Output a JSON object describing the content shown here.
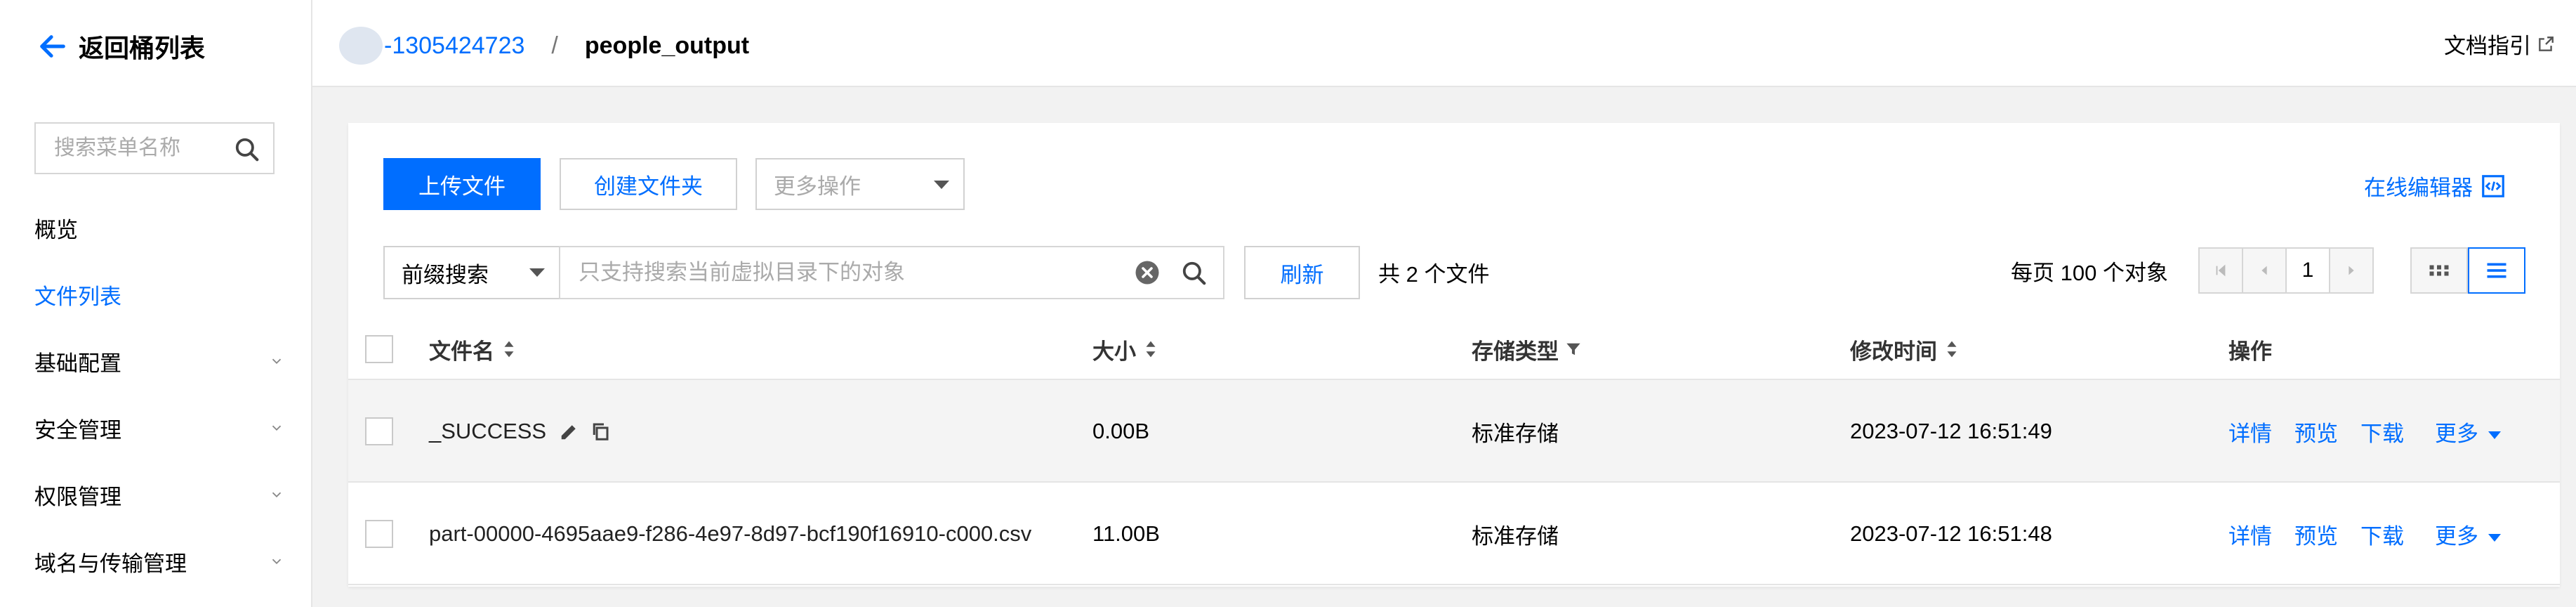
{
  "sidebar": {
    "back_label": "返回桶列表",
    "search_placeholder": "搜索菜单名称",
    "items": [
      {
        "label": "概览",
        "active": false,
        "expandable": false
      },
      {
        "label": "文件列表",
        "active": true,
        "expandable": false
      },
      {
        "label": "基础配置",
        "active": false,
        "expandable": true
      },
      {
        "label": "安全管理",
        "active": false,
        "expandable": true
      },
      {
        "label": "权限管理",
        "active": false,
        "expandable": true
      },
      {
        "label": "域名与传输管理",
        "active": false,
        "expandable": true
      }
    ]
  },
  "header": {
    "bucket": "-1305424723",
    "separator": "/",
    "current": "people_output",
    "doc_link": "文档指引"
  },
  "toolbar": {
    "upload": "上传文件",
    "create_folder": "创建文件夹",
    "more_actions": "更多操作",
    "online_editor": "在线编辑器"
  },
  "search": {
    "mode": "前缀搜索",
    "placeholder": "只支持搜索当前虚拟目录下的对象",
    "refresh": "刷新",
    "total": "共 2 个文件",
    "per_page": "每页 100 个对象",
    "page": "1"
  },
  "table": {
    "headers": {
      "name": "文件名",
      "size": "大小",
      "storage": "存储类型",
      "modified": "修改时间",
      "actions": "操作"
    },
    "rows": [
      {
        "name": "_SUCCESS",
        "size": "0.00B",
        "storage": "标准存储",
        "modified": "2023-07-12 16:51:49"
      },
      {
        "name": "part-00000-4695aae9-f286-4e97-8d97-bcf190f16910-c000.csv",
        "size": "11.00B",
        "storage": "标准存储",
        "modified": "2023-07-12 16:51:48"
      }
    ],
    "row_actions": {
      "detail": "详情",
      "preview": "预览",
      "download": "下载",
      "more": "更多"
    }
  },
  "colors": {
    "accent": "#006eff",
    "border": "#d6d6d6",
    "bg": "#f2f2f2"
  },
  "icons": [
    "arrow-left-icon",
    "search-icon",
    "chevron-down-icon",
    "external-link-icon",
    "code-editor-icon",
    "clear-icon",
    "sort-icon",
    "filter-icon",
    "edit-icon",
    "copy-icon",
    "grid-view-icon",
    "list-view-icon",
    "first-page-icon",
    "prev-page-icon",
    "next-page-icon"
  ]
}
